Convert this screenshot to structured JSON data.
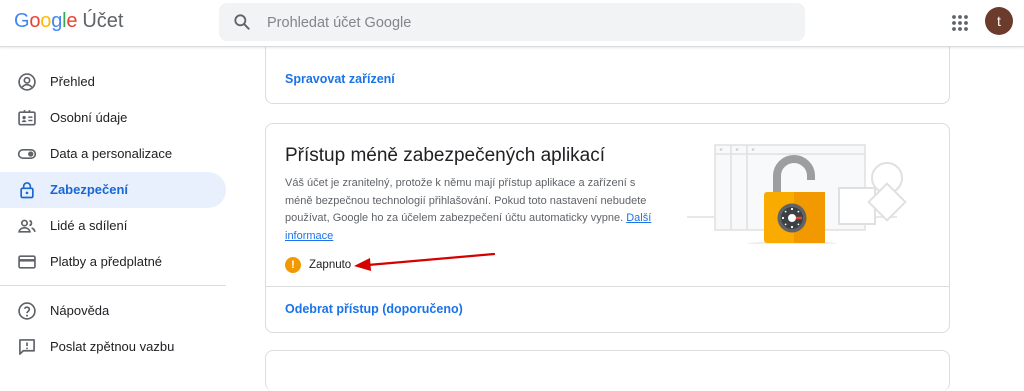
{
  "header": {
    "logo_google": "Google",
    "logo_product": "Účet",
    "search_placeholder": "Prohledat účet Google",
    "apps_icon": "apps-grid-icon",
    "avatar_letter": "t"
  },
  "sidebar": {
    "items": [
      {
        "label": "Přehled",
        "icon": "account-circle-icon",
        "active": false
      },
      {
        "label": "Osobní údaje",
        "icon": "id-card-icon",
        "active": false
      },
      {
        "label": "Data a personalizace",
        "icon": "toggle-icon",
        "active": false
      },
      {
        "label": "Zabezpečení",
        "icon": "lock-icon",
        "active": true
      },
      {
        "label": "Lidé a sdílení",
        "icon": "people-icon",
        "active": false
      },
      {
        "label": "Platby a předplatné",
        "icon": "credit-card-icon",
        "active": false
      },
      {
        "label": "Nápověda",
        "icon": "help-icon",
        "active": false
      },
      {
        "label": "Poslat zpětnou vazbu",
        "icon": "feedback-icon",
        "active": false
      }
    ]
  },
  "main": {
    "devices_card": {
      "link": "Spravovat zařízení"
    },
    "less_secure_card": {
      "title": "Přístup méně zabezpečených aplikací",
      "description": "Váš účet je zranitelný, protože k němu mají přístup aplikace a zařízení s méně bezpečnou technologií přihlašování. Pokud toto nastavení nebudete používat, Google ho za účelem zabezpečení účtu automaticky vypne.",
      "more_link": "Další informace",
      "status": "Zapnuto",
      "action": "Odebrat přístup (doporučeno)"
    }
  },
  "colors": {
    "accent": "#1a73e8",
    "active_bg": "#e8f0fe",
    "warning": "#f29900",
    "annotation_arrow": "#d50000"
  }
}
